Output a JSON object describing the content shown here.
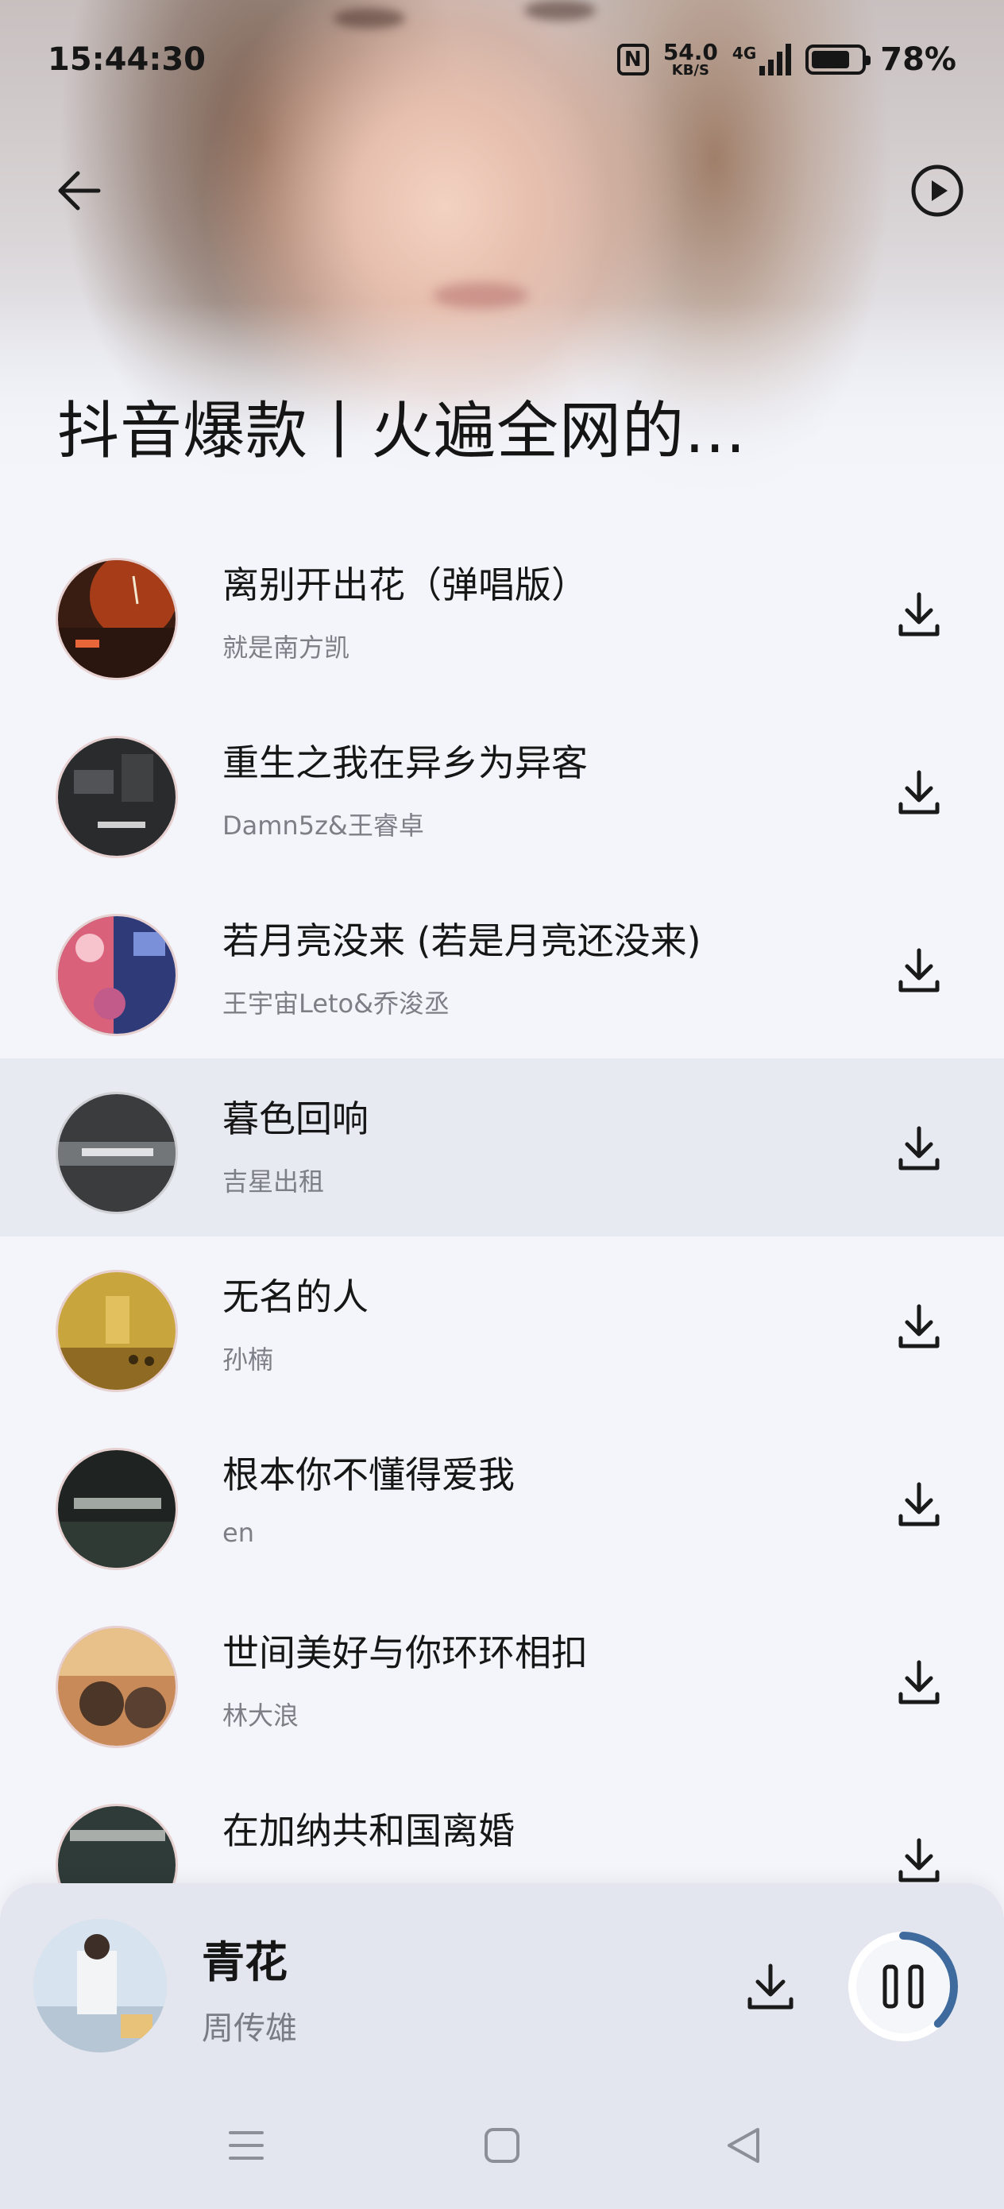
{
  "status_bar": {
    "time": "15:44:30",
    "net_speed": "54.0",
    "net_unit": "KB/S",
    "network": "4G",
    "battery": "78%",
    "battery_level": 0.78
  },
  "header": {
    "back_icon": "arrow-left-icon",
    "play_all_icon": "play-circle-icon",
    "playlist_title": "抖音爆款丨火遍全网的..."
  },
  "songs": [
    {
      "title": "离别开出花（弹唱版）",
      "artist": "就是南方凯"
    },
    {
      "title": "重生之我在异乡为异客",
      "artist": "Damn5z&王睿卓"
    },
    {
      "title": "若月亮没来 (若是月亮还没来)",
      "artist": "王宇宙Leto&乔浚丞"
    },
    {
      "title": "暮色回响",
      "artist": "吉星出租"
    },
    {
      "title": "无名的人",
      "artist": "孙楠"
    },
    {
      "title": "根本你不懂得爱我",
      "artist": "en"
    },
    {
      "title": "世间美好与你环环相扣",
      "artist": "林大浪"
    },
    {
      "title": "在加纳共和国离婚",
      "artist": ""
    }
  ],
  "mini_player": {
    "title": "青花",
    "artist": "周传雄",
    "progress": 0.38,
    "accent": "#3e6a9e"
  },
  "system_nav": {
    "menu_icon": "menu-icon",
    "home_icon": "home-square-icon",
    "back_icon": "back-triangle-icon"
  }
}
